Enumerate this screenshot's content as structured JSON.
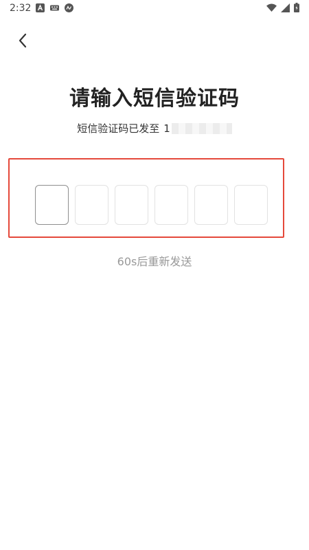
{
  "status_bar": {
    "time": "2:32",
    "left_icons": [
      "notification-a-icon",
      "keyboard-icon",
      "vpn-icon"
    ],
    "right_icons": [
      "wifi-icon",
      "signal-icon",
      "battery-icon"
    ]
  },
  "nav": {
    "back_icon": "chevron-left-icon"
  },
  "page": {
    "title": "请输入短信验证码",
    "subtitle": "短信验证码已发至",
    "phone_visible_prefix": "1"
  },
  "code_input": {
    "digits": [
      "",
      "",
      "",
      "",
      "",
      ""
    ],
    "active_index": 0,
    "highlight_color": "#e5483a"
  },
  "resend": {
    "label": "60s后重新发送"
  },
  "colors": {
    "title": "#222222",
    "resend": "#999999",
    "box_border": "#e2e2e2"
  }
}
